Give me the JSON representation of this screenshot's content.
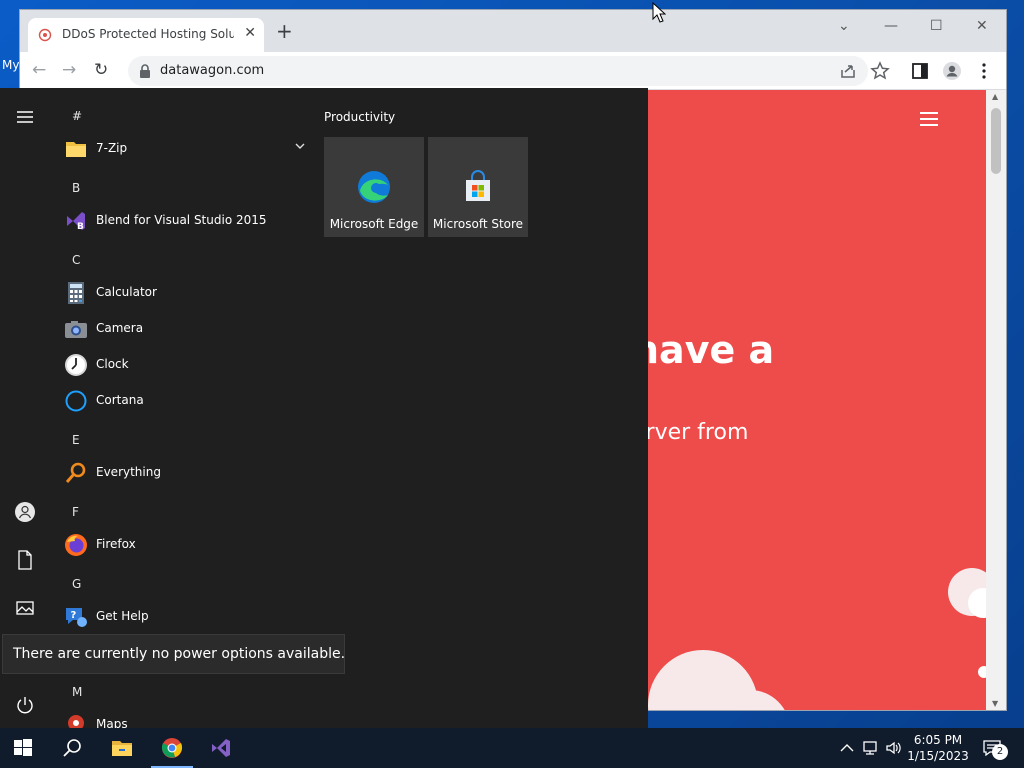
{
  "desktop": {
    "label": "My"
  },
  "browser": {
    "tab_title": "DDoS Protected Hosting Solution",
    "url": "datawagon.com",
    "page": {
      "headline": "have a",
      "subline": "erver from"
    }
  },
  "start_menu": {
    "sections": [
      {
        "letter": "#",
        "apps": [
          {
            "label": "7-Zip",
            "icon": "folder-icon",
            "expandable": true
          }
        ]
      },
      {
        "letter": "B",
        "apps": [
          {
            "label": "Blend for Visual Studio 2015",
            "icon": "blend-icon"
          }
        ]
      },
      {
        "letter": "C",
        "apps": [
          {
            "label": "Calculator",
            "icon": "calculator-icon"
          },
          {
            "label": "Camera",
            "icon": "camera-icon"
          },
          {
            "label": "Clock",
            "icon": "clock-icon"
          },
          {
            "label": "Cortana",
            "icon": "cortana-icon"
          }
        ]
      },
      {
        "letter": "E",
        "apps": [
          {
            "label": "Everything",
            "icon": "everything-icon"
          }
        ]
      },
      {
        "letter": "F",
        "apps": [
          {
            "label": "Firefox",
            "icon": "firefox-icon"
          }
        ]
      },
      {
        "letter": "G",
        "apps": [
          {
            "label": "Get Help",
            "icon": "help-icon"
          }
        ]
      },
      {
        "letter": "M",
        "apps": [
          {
            "label": "Maps",
            "icon": "maps-icon"
          }
        ]
      }
    ],
    "group_title": "Productivity",
    "tiles": [
      {
        "label": "Microsoft Edge",
        "icon": "edge-icon"
      },
      {
        "label": "Microsoft Store",
        "icon": "store-icon"
      }
    ],
    "power_tooltip": "There are currently no power options available."
  },
  "taskbar": {
    "time": "6:05 PM",
    "date": "1/15/2023",
    "notification_count": "2"
  }
}
